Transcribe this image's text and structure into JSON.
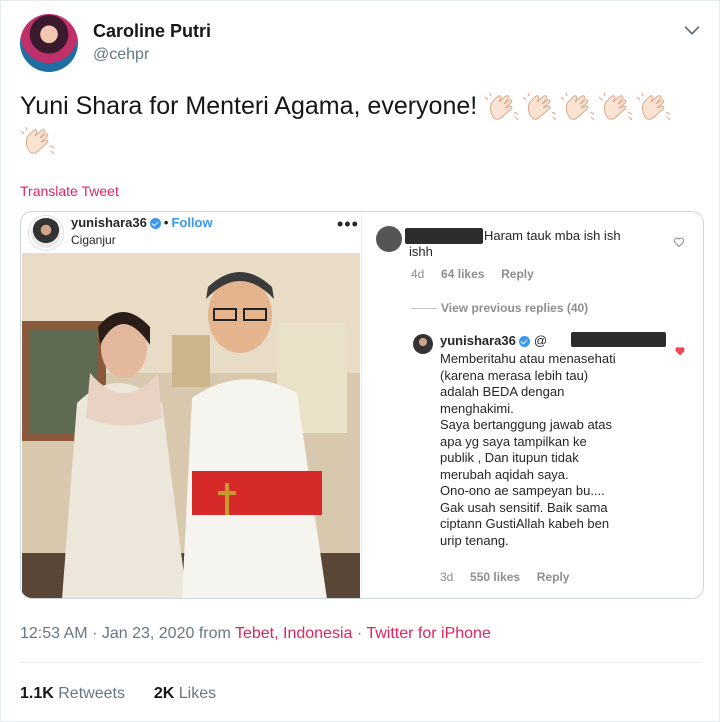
{
  "user": {
    "display_name": "Caroline Putri",
    "handle": "@cehpr"
  },
  "tweet": {
    "text": "Yuni Shara for Menteri Agama, everyone!",
    "emoji": "clapping-hands-emoji",
    "emoji_count": 6,
    "translate_label": "Translate Tweet"
  },
  "instagram": {
    "username": "yunishara36",
    "follow_label": "Follow",
    "location": "Ciganjur",
    "more": "•••",
    "comment1": {
      "text_line1": "Haram tauk mba ish ish",
      "text_line2": "ishh",
      "age": "4d",
      "likes": "64 likes",
      "reply": "Reply"
    },
    "view_previous": "View previous replies (40)",
    "comment2": {
      "username": "yunishara36",
      "mention_prefix": "@",
      "lines": [
        "Memberitahu atau menasehati",
        "(karena merasa lebih tau)",
        "adalah BEDA dengan",
        "menghakimi.",
        "Saya bertanggung jawab atas",
        "apa yg saya tampilkan ke",
        "publik ,  Dan itupun tidak",
        "merubah aqidah saya.",
        "Ono-ono ae sampeyan bu....",
        "Gak usah sensitif. Baik sama",
        "ciptann GustiAllah kabeh ben",
        "urip tenang."
      ],
      "age": "3d",
      "likes": "550 likes",
      "reply": "Reply"
    }
  },
  "footer": {
    "time": "12:53 AM",
    "date": "Jan 23, 2020",
    "from_word": "from",
    "location": "Tebet, Indonesia",
    "dot": "·",
    "client": "Twitter for iPhone"
  },
  "stats": {
    "retweets_count": "1.1K",
    "retweets_label": "Retweets",
    "likes_count": "2K",
    "likes_label": "Likes"
  },
  "colors": {
    "accent": "#e0245e",
    "secondary_text": "#657786",
    "ig_blue": "#3897f0"
  }
}
